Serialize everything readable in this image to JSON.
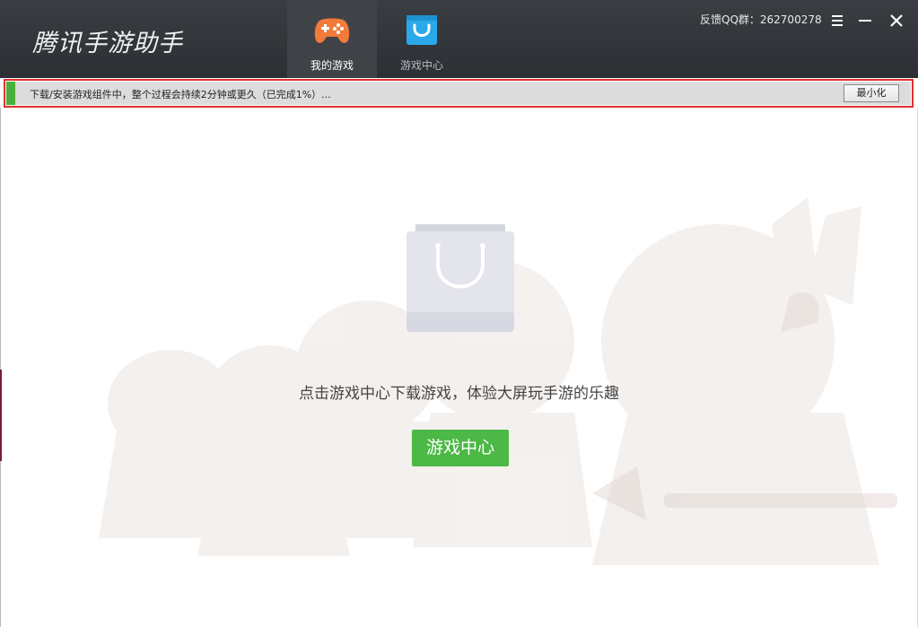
{
  "app": {
    "title": "腾讯手游助手"
  },
  "nav": {
    "tabs": [
      {
        "label": "我的游戏",
        "icon": "gamepad-icon",
        "active": true
      },
      {
        "label": "游戏中心",
        "icon": "shopping-bag-icon",
        "active": false
      }
    ]
  },
  "header": {
    "feedback": "反馈QQ群：262700278"
  },
  "window_controls": {
    "menu_icon": "menu-icon",
    "minimize_icon": "minimize-icon",
    "close_icon": "close-icon"
  },
  "download": {
    "status_text": "下载/安装游戏组件中，整个过程会持续2分钟或更久（已完成1%）...",
    "progress": 0.01,
    "minimize_label": "最小化"
  },
  "empty_state": {
    "icon": "shopping-bag-icon",
    "message": "点击游戏中心下载游戏，体验大屏玩手游的乐趣",
    "button_label": "游戏中心"
  },
  "colors": {
    "accent_green": "#4cb845",
    "highlight_red": "#e0302f",
    "titlebar": "#2f3236",
    "gamepad_orange": "#f27a3a",
    "bag_blue": "#29a9ea"
  }
}
